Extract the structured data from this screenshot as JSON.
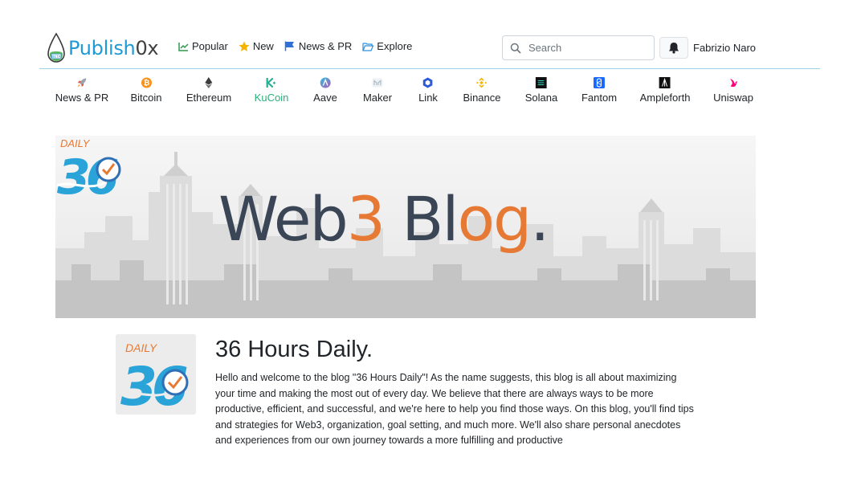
{
  "header": {
    "logo": {
      "part1": "Publish",
      "part2": "0x"
    },
    "nav": [
      {
        "label": "Popular",
        "icon": "chart-line-icon"
      },
      {
        "label": "New",
        "icon": "star-icon"
      },
      {
        "label": "News & PR",
        "icon": "flag-icon"
      },
      {
        "label": "Explore",
        "icon": "folder-open-icon"
      }
    ],
    "search": {
      "placeholder": "Search",
      "value": ""
    },
    "user": {
      "name": "Fabrizio Naro"
    }
  },
  "categories": [
    {
      "label": "News & PR",
      "icon": "rocket-icon",
      "active": false
    },
    {
      "label": "Bitcoin",
      "icon": "bitcoin-icon",
      "active": false
    },
    {
      "label": "Ethereum",
      "icon": "ethereum-icon",
      "active": false
    },
    {
      "label": "KuCoin",
      "icon": "kucoin-icon",
      "active": true
    },
    {
      "label": "Aave",
      "icon": "aave-icon",
      "active": false
    },
    {
      "label": "Maker",
      "icon": "maker-icon",
      "active": false
    },
    {
      "label": "Link",
      "icon": "chainlink-icon",
      "active": false
    },
    {
      "label": "Binance",
      "icon": "binance-icon",
      "active": false
    },
    {
      "label": "Solana",
      "icon": "solana-icon",
      "active": false
    },
    {
      "label": "Fantom",
      "icon": "fantom-icon",
      "active": false
    },
    {
      "label": "Ampleforth",
      "icon": "ampleforth-icon",
      "active": false
    },
    {
      "label": "Uniswap",
      "icon": "uniswap-icon",
      "active": false
    }
  ],
  "banner": {
    "title_part1": "Web",
    "title_part2": "3",
    "title_part3": " Bl",
    "title_part4": "og",
    "title_part5": ".",
    "logo_word": "DAILY",
    "logo_number": "36"
  },
  "blog": {
    "title": "36 Hours Daily.",
    "description": "Hello and welcome to the blog \"36 Hours Daily\"! As the name suggests, this blog is all about maximizing your time and making the most out of every day. We believe that there are always ways to be more productive, efficient, and successful, and we're here to help you find those ways. On this blog, you'll find tips and strategies for Web3, organization, goal setting, and much more. We'll also share personal anecdotes and experiences from our own journey towards a more fulfilling and productive",
    "avatar_word": "DAILY",
    "avatar_number": "36"
  },
  "colors": {
    "brand_blue": "#1e9bd7",
    "active_green": "#28b07a",
    "banner_dark": "#3a4556",
    "banner_orange": "#e67a35"
  }
}
